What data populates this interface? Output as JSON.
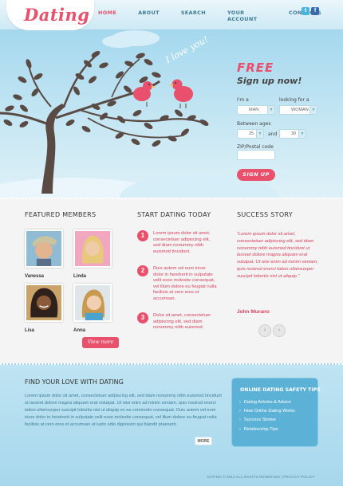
{
  "header": {
    "logo": "Dating",
    "nav": [
      "HOME",
      "ABOUT",
      "SEARCH",
      "YOUR ACCOUNT",
      "CONTACTS"
    ],
    "social": [
      "t",
      "f"
    ]
  },
  "hero": {
    "love_text": "I love you!",
    "signup": {
      "free_label": "FREE",
      "title": "Sign up now!",
      "im_label": "I'm a",
      "looking_label": "looking for a",
      "gender_value": "MAN",
      "looking_value": "WOMAN",
      "ages_label": "Between ages",
      "age_from": "25",
      "and_label": "and",
      "age_to": "30",
      "zip_label": "ZIP/Postal code",
      "button": "SIGN UP"
    }
  },
  "featured": {
    "title": "FEATURED MEMBERS",
    "members": [
      {
        "name": "Vanessa"
      },
      {
        "name": "Linda"
      },
      {
        "name": "Lisa"
      },
      {
        "name": "Anna"
      }
    ],
    "button": "View more"
  },
  "start": {
    "title": "START DATING TODAY",
    "steps": [
      {
        "num": "1",
        "text": "Lorem ipsum dolor sit amet, consectetuer adipiscing elit, sed diam nonummy nibh euismod tincidunt."
      },
      {
        "num": "2",
        "text": "Duis autem vel eum iriure dolor in hendrerit in vulputate velit esse molestie consequat, vel illum dolore eu feugiat nulla facilisis at vero eros et accumsan."
      },
      {
        "num": "3",
        "text": "Dolor sit amet, consectetuer adipiscing elit, sed diam nonummy nibh euismod."
      }
    ]
  },
  "story": {
    "title": "SUCCESS STORY",
    "text": "“Lorem ipsum dolor sit amet, consectetuer adipiscing elit, sed diam nonummy nibh euismod tincidunt ut laoreet dolore magna aliquam erat volutpat. Ut wisi enim ad minim veniam, quis nostrud exerci tation ullamcorper suscipit lobortis nisl ut aliquip.”",
    "author": "John Murano",
    "prev": "‹",
    "next": "›"
  },
  "find": {
    "title": "FIND YOUR LOVE WITH DATING",
    "text": "Lorem ipsum dolor sit amet, consectetuer adipiscing elit, sed diam nonummy nibh euismod tincidunt ut laoreet dolore magna aliquam erat volutpat. Ut wisi enim ad minim veniam, quis nostrud exerci tation ullamcorper suscipit lobortis nisl ut aliquip ex ea commodo consequat. Duis autem vel eum iriure dolor in hendrerit in vulputate velit esse molestie consequat, vel illum dolore eu feugiat nulla facilisis at vero eros et accumsan et iusto odio dignissim qui blandit praesent.",
    "more": "MORE"
  },
  "tips": {
    "title": "ONLINE DATING SAFETY TIPS",
    "items": [
      "Dating Articles & Advice",
      "How Online Dating Works",
      "Success Stories",
      "Relationship Tips"
    ]
  },
  "footer": {
    "text": "DATING © 2012 ALL RIGHTS RESERVED | PRIVACY POLICY"
  },
  "colors": {
    "accent": "#e8506c",
    "sky": "#a5d8ee",
    "trunk": "#5a4a44"
  }
}
